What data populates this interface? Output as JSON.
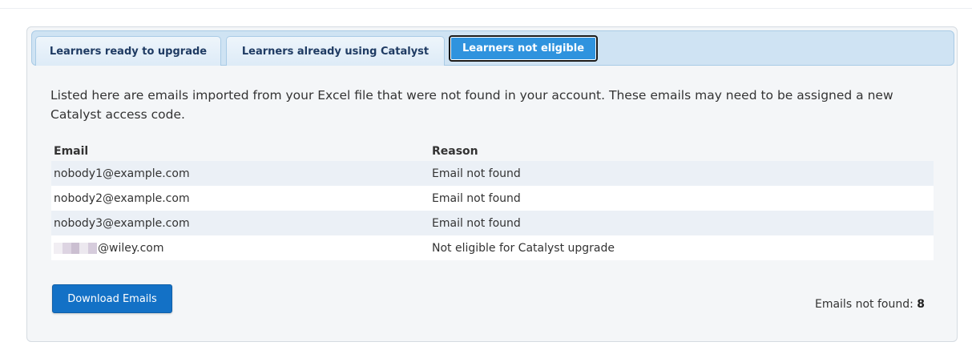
{
  "tabs": [
    {
      "label": "Learners ready to upgrade"
    },
    {
      "label": "Learners already using Catalyst"
    },
    {
      "label": "Learners not eligible"
    }
  ],
  "description": "Listed here are emails imported from your Excel file that were not found in your account. These emails may need to be assigned a new Catalyst access code.",
  "table": {
    "headers": {
      "email": "Email",
      "reason": "Reason"
    },
    "rows": [
      {
        "email": "nobody1@example.com",
        "reason": "Email not found"
      },
      {
        "email": "nobody2@example.com",
        "reason": "Email not found"
      },
      {
        "email": "nobody3@example.com",
        "reason": "Email not found"
      },
      {
        "email": "@wiley.com",
        "reason": "Not eligible for Catalyst upgrade"
      }
    ]
  },
  "download_button": "Download Emails",
  "summary": {
    "label": "Emails not found:",
    "value": "8"
  },
  "colors": {
    "accent": "#1371c6",
    "active_tab": "#2f93de",
    "tab_bar": "#cfe3f3"
  }
}
